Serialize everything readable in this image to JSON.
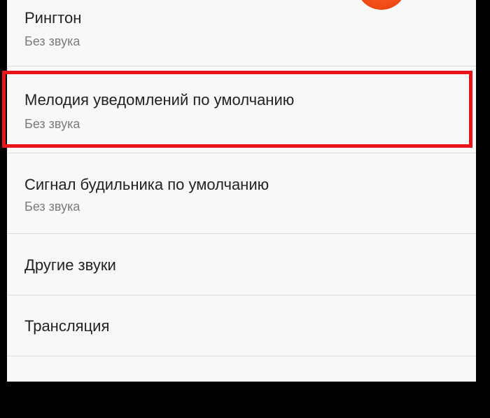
{
  "settings": {
    "items": [
      {
        "title": "Рингтон",
        "summary": "Без звука"
      },
      {
        "title": "Мелодия уведомлений по умолчанию",
        "summary": "Без звука"
      },
      {
        "title": "Сигнал будильника по умолчанию",
        "summary": "Без звука"
      },
      {
        "title": "Другие звуки"
      },
      {
        "title": "Трансляция"
      }
    ]
  },
  "colors": {
    "highlight_border": "#e8141b",
    "indicator": "#f04a14",
    "background": "#f8f8f8",
    "frame": "#000000"
  }
}
